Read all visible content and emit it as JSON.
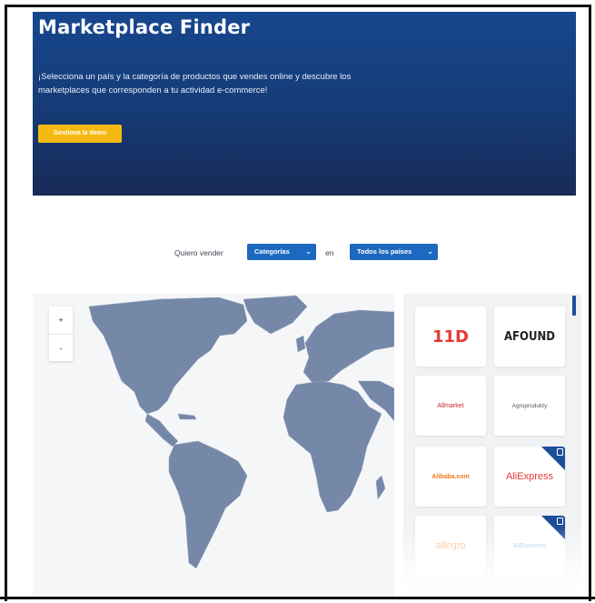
{
  "hero": {
    "title": "Marketplace Finder",
    "description": "¡Selecciona un país y la categoría de productos que vendes online y descubre los marketplaces que corresponden a tu actividad e-commerce!",
    "cta_label": "Gestiona la demo"
  },
  "filters": {
    "label_sell": "Quiero vender",
    "category_select": "Categorías",
    "label_in": "en",
    "country_select": "Todos los países"
  },
  "map": {
    "zoom_in_label": "+",
    "zoom_out_label": "-",
    "land_color": "#7588a8",
    "background_color": "#f5f6f8"
  },
  "marketplaces": [
    {
      "name": "11D",
      "color": "#e53935",
      "featured": false
    },
    {
      "name": "AFOUND",
      "color": "#222222",
      "featured": false
    },
    {
      "name": "Allmarket",
      "color": "#c62828",
      "featured": false
    },
    {
      "name": "Agroprodukty",
      "color": "#555555",
      "featured": false
    },
    {
      "name": "Alibaba.com",
      "color": "#f07820",
      "featured": false
    },
    {
      "name": "AliExpress",
      "color": "#e53935",
      "featured": true
    },
    {
      "name": "allegro",
      "color": "#f58220",
      "featured": false
    },
    {
      "name": "AllBusiness",
      "color": "#5a8fd0",
      "featured": true
    }
  ],
  "colors": {
    "hero_top": "#17478e",
    "hero_bottom": "#172b57",
    "cta": "#f4b912",
    "select": "#1d69bf",
    "badge": "#1d4e99"
  }
}
